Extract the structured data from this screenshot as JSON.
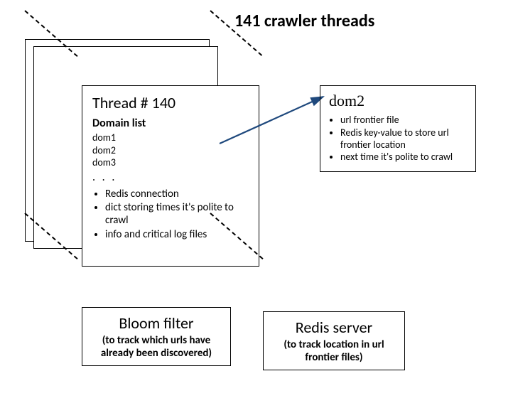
{
  "title": "141 crawler threads",
  "thread": {
    "title": "Thread # 140",
    "domain_list_label": "Domain list",
    "domains": [
      "dom1",
      "dom2",
      "dom3"
    ],
    "ellipsis": ". . .",
    "bullets": [
      "Redis connection",
      "dict storing times it's polite to crawl",
      "info and critical log files"
    ]
  },
  "dom_detail": {
    "title": "dom2",
    "bullets": [
      "url frontier file",
      "Redis key-value to store url frontier location",
      "next time it's polite to crawl"
    ]
  },
  "bloom": {
    "title": "Bloom filter",
    "sub": "(to track which urls have already been discovered)"
  },
  "redis": {
    "title": "Redis server",
    "sub": "(to track location in url frontier files)"
  }
}
